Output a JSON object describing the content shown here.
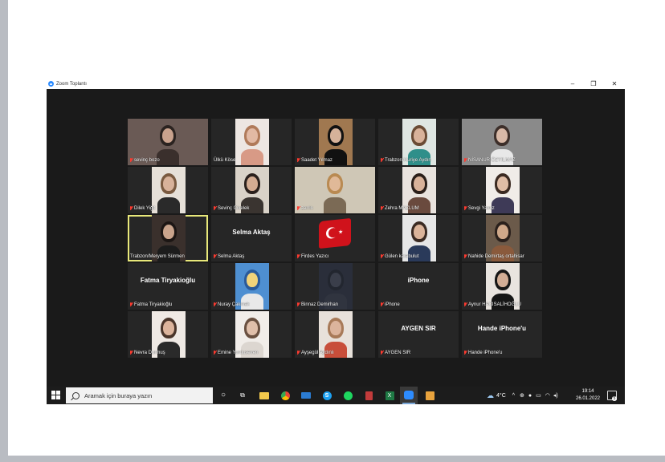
{
  "window": {
    "title": "Zoom Toplantı",
    "controls": [
      "–",
      "❐",
      "✕"
    ]
  },
  "participants": [
    {
      "name": "sevinç bozo",
      "video": true,
      "muted": true
    },
    {
      "name": "Ülkü Köse",
      "video": true,
      "muted": false
    },
    {
      "name": "Saadet Yılmaz",
      "video": true,
      "muted": true
    },
    {
      "name": "Trabzon-Huriye Aydın",
      "video": true,
      "muted": true
    },
    {
      "name": "NİSANUR ÖZYILMAZ",
      "video": true,
      "muted": true
    },
    {
      "name": "Dilek Yiğit",
      "video": true,
      "muted": true
    },
    {
      "name": "Sevinç Civelek",
      "video": true,
      "muted": true
    },
    {
      "name": "zerrin",
      "video": true,
      "muted": true
    },
    {
      "name": "Zehra MAZLUM",
      "video": true,
      "muted": true
    },
    {
      "name": "Sevgi Yavuz",
      "video": true,
      "muted": true
    },
    {
      "name": "Trabzon/Meryem Sürmen",
      "video": true,
      "muted": false,
      "active_speaker": true
    },
    {
      "name": "Selma Aktaş",
      "video": false,
      "muted": true,
      "display": "Selma Aktaş"
    },
    {
      "name": "Firdes Yazıcı",
      "video": true,
      "muted": true
    },
    {
      "name": "Gülen karabulut",
      "video": true,
      "muted": true
    },
    {
      "name": "Nahide Demirtaş ortahisar",
      "video": true,
      "muted": true
    },
    {
      "name": "Fatma Tiryakioğlu",
      "video": false,
      "muted": true,
      "display": "Fatma Tiryakioğlu"
    },
    {
      "name": "Nuray Çakmak",
      "video": true,
      "muted": true
    },
    {
      "name": "Binnaz Demirhan",
      "video": true,
      "muted": true
    },
    {
      "name": "iPhone",
      "video": false,
      "muted": true,
      "display": "iPhone"
    },
    {
      "name": "Aynur HACISALİHOĞLU",
      "video": true,
      "muted": true
    },
    {
      "name": "Nevra Durmuş",
      "video": true,
      "muted": true
    },
    {
      "name": "Emine Yurduseven",
      "video": true,
      "muted": true
    },
    {
      "name": "Ayşegül Aydınlı",
      "video": true,
      "muted": true
    },
    {
      "name": "AYGEN SIR",
      "video": false,
      "muted": true,
      "display": "AYGEN SIR"
    },
    {
      "name": "Hande iPhone'u",
      "video": false,
      "muted": true,
      "display": "Hande iPhone'u"
    }
  ],
  "taskbar": {
    "search_placeholder": "Aramak için buraya yazın",
    "apps": [
      "task-view",
      "explorer",
      "chrome",
      "mail",
      "skype",
      "spotify",
      "app-red",
      "excel",
      "zoom",
      "paint"
    ],
    "weather": "4°C",
    "time": "19:14",
    "date": "26.01.2022",
    "notification_count": "5"
  },
  "colors": {
    "window_bg": "#1a1a1a",
    "tile_bg": "#262626",
    "active_border": "#e8e87a",
    "mute": "#ff3b30",
    "zoom_blue": "#2d8cff"
  }
}
